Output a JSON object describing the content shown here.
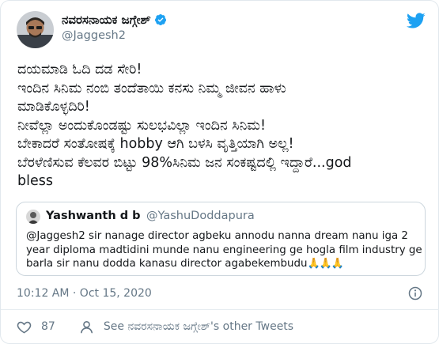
{
  "author": {
    "name": "ನವರಸನಾಯಕ ಜಗ್ಗೇಶ್",
    "handle": "@Jaggesh2",
    "verified": true
  },
  "tweet": {
    "lines": [
      "ದಯಮಾಡಿ ಓದಿ ದಡ ಸೇರಿ!",
      "ಇಂದಿನ ಸಿನಿಮ ನಂಬಿ ತಂದೆತಾಯಿ ಕನಸು ನಿಮ್ಮ ಜೀವನ ಹಾಳು",
      "ಮಾಡಿಕೊಳ್ಳದಿರಿ!",
      "ನೀವೆಲ್ಲಾ ಅಂದುಕೊಂಡಷ್ಟು ಸುಲಭವಿಲ್ಲಾ ಇಂದಿನ ಸಿನಿಮ!",
      "ಬೇಕಾದರೆ ಸಂತೋಷಕ್ಕೆ hobby ಆಗಿ ಬಳಸಿ ವೃತ್ತಿಯಾಗಿ ಅಲ್ಲ!",
      "ಬೆರಳೆಣಿಸುವ ಕೆಲವರ ಬಿಟ್ಟು 98%ಸಿನಿಮ ಜನ ಸಂಕಷ್ಟದಲ್ಲಿ ಇದ್ದಾರೆ...god",
      "bless"
    ]
  },
  "quoted": {
    "name": "Yashwanth d b",
    "handle": "@YashuDoddapura",
    "lines": [
      "@Jaggesh2 sir nanage director agbeku annodu nanna dream nanu iga 2",
      "year diploma madtidini munde nanu engineering ge hogla film industry ge",
      "barla sir nanu dodda kanasu director agabekembudu"
    ],
    "emoji": "🙏🙏🙏"
  },
  "meta": {
    "timestamp": "10:12 AM · Oct 15, 2020"
  },
  "actions": {
    "like_count": "87",
    "other_tweets_label": "See ನವರಸನಾಯಕ ಜಗ್ಗೇಶ್'s other Tweets"
  },
  "colors": {
    "brand": "#1da1f2",
    "text": "#14171a",
    "secondary": "#657786",
    "border": "#e1e8ed"
  },
  "icons": {
    "verified": "verified-badge-icon",
    "logo": "twitter-bird-icon",
    "info": "info-icon",
    "like": "heart-icon",
    "profile": "person-icon"
  }
}
